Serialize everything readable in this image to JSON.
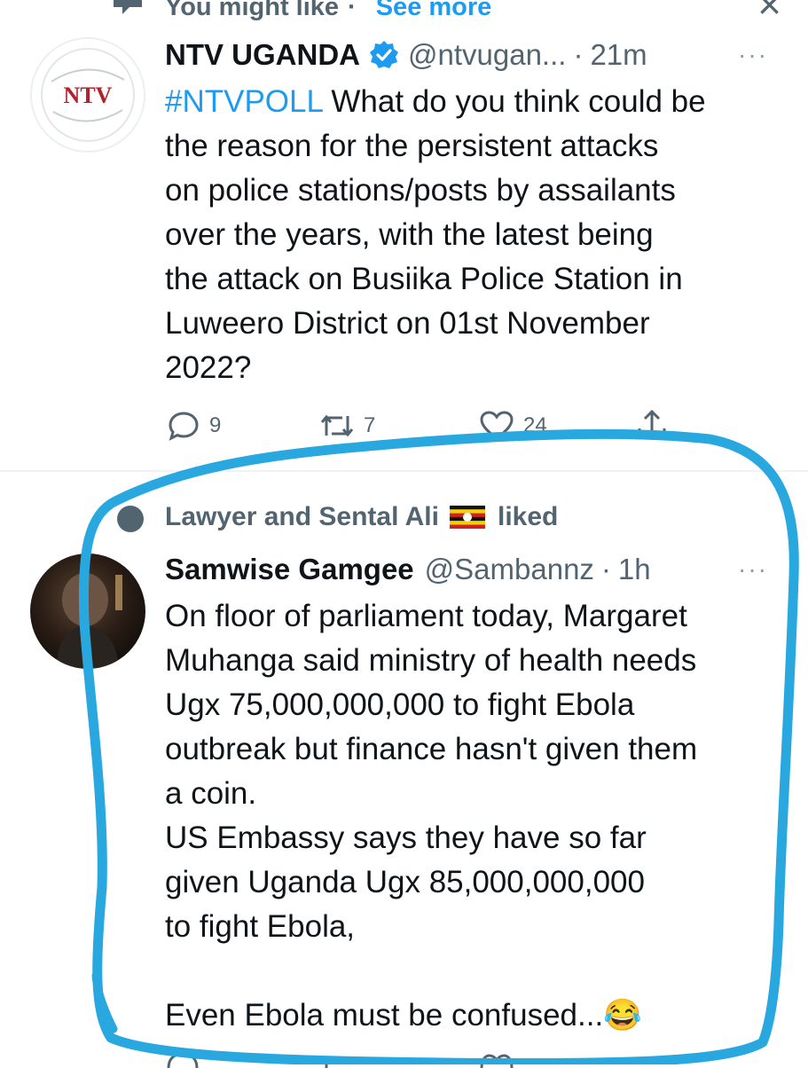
{
  "context": {
    "label": "You might like",
    "separator": "·",
    "see_more": "See more"
  },
  "tweet1": {
    "display_name": "NTV UGANDA",
    "handle": "@ntvugan...",
    "separator": "·",
    "time": "21m",
    "avatar_text": "NTV",
    "hashtag": "#NTVPOLL",
    "text": " What do you think could be\nthe reason for the persistent attacks\non police stations/posts by assailants\nover the years, with the latest being\nthe attack on Busiika Police Station in\nLuweero District on 01st November\n2022?",
    "reply_count": "9",
    "retweet_count": "7",
    "like_count": "24"
  },
  "liked": {
    "text": "Lawyer and Sental Ali",
    "suffix": "liked"
  },
  "tweet2": {
    "display_name": "Samwise Gamgee",
    "handle": "@Sambannz",
    "separator": "·",
    "time": "1h",
    "text": "On floor of parliament today, Margaret\nMuhanga said ministry of health needs\nUgx 75,000,000,000 to fight Ebola\noutbreak but finance hasn't given them\na coin.\nUS Embassy says they have so far\ngiven Uganda Ugx 85,000,000,000\nto fight Ebola,\n\nEven Ebola must be confused...",
    "emoji": "😂"
  },
  "icons": {
    "context": "sparkle-bubble-icon",
    "close": "close-icon",
    "verified": "verified-badge-icon",
    "more": "more-options-icon",
    "reply": "reply-icon",
    "retweet": "retweet-icon",
    "like": "heart-icon",
    "share": "share-icon",
    "flag": "uganda-flag-icon"
  },
  "colors": {
    "accent": "#1d9bf0",
    "highlight": "#29a8e0",
    "muted": "#536471",
    "text": "#0f1419",
    "ntv_red": "#b7202a"
  }
}
